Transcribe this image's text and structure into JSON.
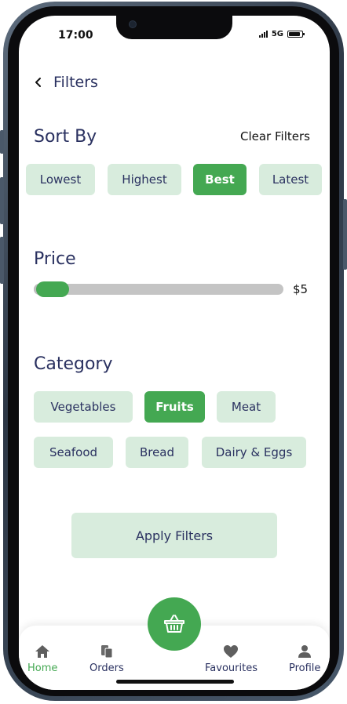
{
  "status_bar": {
    "time": "17:00",
    "network": "5G"
  },
  "header": {
    "title": "Filters",
    "back_icon": "chevron-left-icon"
  },
  "sort": {
    "title": "Sort By",
    "clear_label": "Clear Filters",
    "options": [
      "Lowest",
      "Highest",
      "Best",
      "Latest"
    ],
    "selected": "Best"
  },
  "price": {
    "title": "Price",
    "value_label": "$5",
    "slider_fraction": 0.0
  },
  "category": {
    "title": "Category",
    "options": [
      "Vegetables",
      "Fruits",
      "Meat",
      "Seafood",
      "Bread",
      "Dairy & Eggs"
    ],
    "selected": "Fruits"
  },
  "apply_label": "Apply Filters",
  "tabs": [
    {
      "label": "Home",
      "icon": "home-icon",
      "active": true
    },
    {
      "label": "Orders",
      "icon": "orders-icon",
      "active": false
    },
    {
      "label": "Favourites",
      "icon": "heart-icon",
      "active": false
    },
    {
      "label": "Profile",
      "icon": "user-icon",
      "active": false
    }
  ],
  "fab_icon": "basket-icon",
  "colors": {
    "accent": "#44a852",
    "chip_bg": "#d8ecdd",
    "text_primary": "#2a3160",
    "track": "#c4c4c4"
  }
}
